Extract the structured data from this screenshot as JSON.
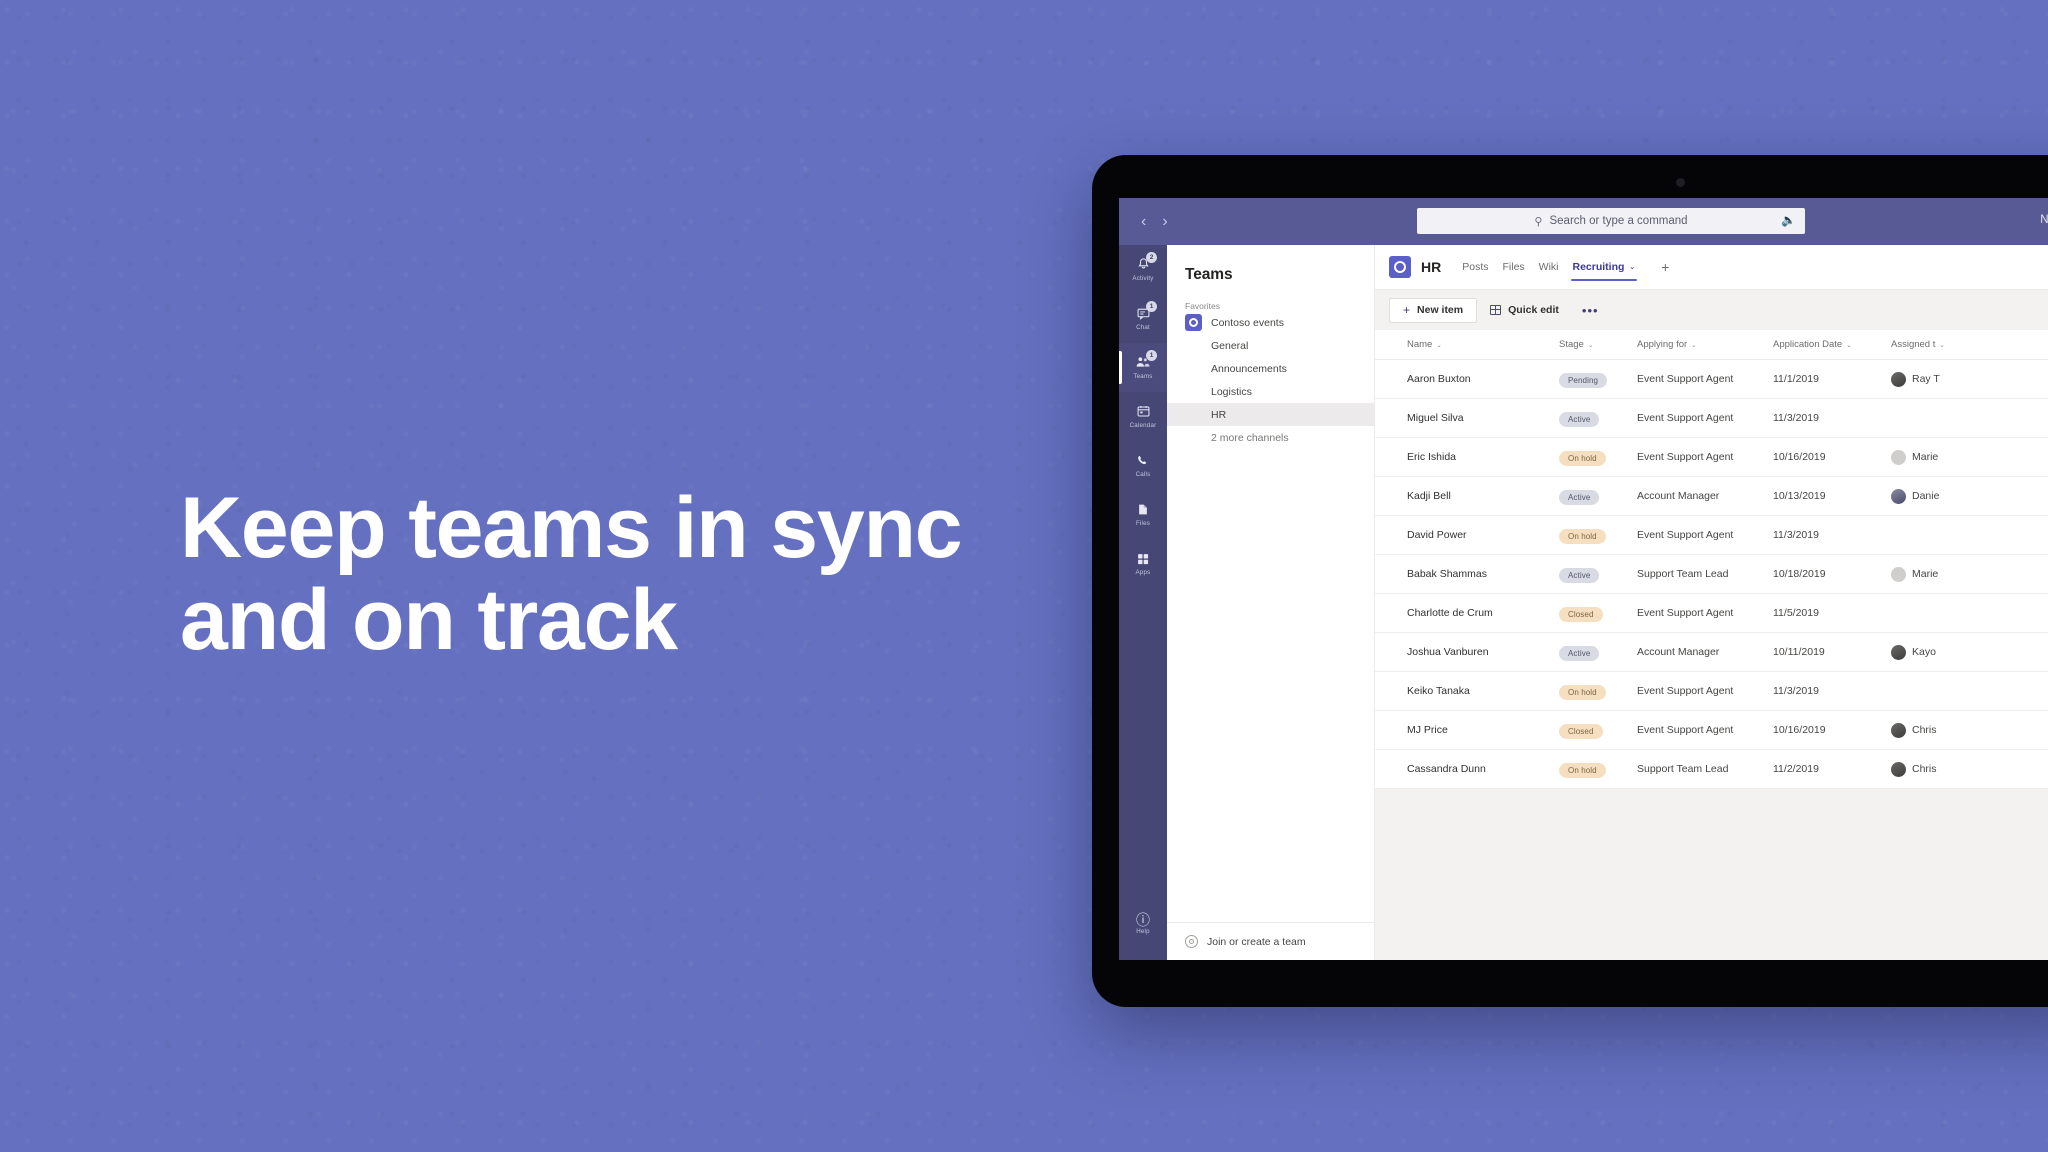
{
  "theme": {
    "background": "#6571c0",
    "teams_purple": "#464775",
    "teams_titlebar": "#585a96",
    "accent": "#5b5fc7",
    "content_bg": "#f3f2f1",
    "pill_gray_bg": "#d8dae4",
    "pill_orange_bg": "#f6dfc0"
  },
  "headline": "Keep teams in sync\nand on track",
  "titlebar": {
    "back_icon": "‹",
    "forward_icon": "›",
    "search_icon": "search-icon",
    "search_placeholder": "Search or type a command",
    "mic_icon": "ƨ",
    "org_name": "Northwind T"
  },
  "rail": {
    "items": [
      {
        "label": "Activity",
        "glyph": "⬤",
        "icon": "bell-icon",
        "badge": "2",
        "active": false
      },
      {
        "label": "Chat",
        "glyph": "⬤",
        "icon": "chat-icon",
        "badge": "1",
        "active": false
      },
      {
        "label": "Teams",
        "glyph": "⬤",
        "icon": "teams-icon",
        "badge": "1",
        "active": true
      },
      {
        "label": "Calendar",
        "glyph": "⬤",
        "icon": "calendar-icon",
        "badge": "",
        "active": false
      },
      {
        "label": "Calls",
        "glyph": "⬤",
        "icon": "phone-icon",
        "badge": "",
        "active": false
      },
      {
        "label": "Files",
        "glyph": "⬤",
        "icon": "files-icon",
        "badge": "",
        "active": false
      },
      {
        "label": "Apps",
        "glyph": "⬤",
        "icon": "apps-grid-icon",
        "badge": "",
        "active": false
      }
    ],
    "help": {
      "label": "Help",
      "icon": "help-circle-icon"
    }
  },
  "teams_panel": {
    "title": "Teams",
    "section_label": "Favorites",
    "team": {
      "name": "Contoso events",
      "icon": "team-avatar-icon"
    },
    "channels": [
      {
        "name": "General",
        "selected": false,
        "muted": false
      },
      {
        "name": "Announcements",
        "selected": false,
        "muted": false
      },
      {
        "name": "Logistics",
        "selected": false,
        "muted": false
      },
      {
        "name": "HR",
        "selected": true,
        "muted": false
      },
      {
        "name": "2 more channels",
        "selected": false,
        "muted": true
      }
    ],
    "join_team": {
      "label": "Join or create a team",
      "icon": "join-team-icon"
    }
  },
  "channel_header": {
    "avatar_icon": "team-avatar-icon",
    "name": "HR",
    "tabs": [
      {
        "label": "Posts",
        "active": false,
        "chevron": false
      },
      {
        "label": "Files",
        "active": false,
        "chevron": false
      },
      {
        "label": "Wiki",
        "active": false,
        "chevron": false
      },
      {
        "label": "Recruiting",
        "active": true,
        "chevron": true
      }
    ],
    "chevron_icon": "⌄",
    "add_tab_icon": "+"
  },
  "list_toolbar": {
    "new_item": {
      "label": "New item",
      "plus": "+",
      "icon": "plus-icon"
    },
    "quick_edit": {
      "label": "Quick edit",
      "icon": "grid-table-icon"
    },
    "more": {
      "label": "•••",
      "icon": "ellipsis-icon"
    }
  },
  "table": {
    "columns": [
      {
        "label": "Name",
        "key": "name"
      },
      {
        "label": "Stage",
        "key": "stage"
      },
      {
        "label": "Applying for",
        "key": "applying_for"
      },
      {
        "label": "Application Date",
        "key": "application_date"
      },
      {
        "label": "Assigned t",
        "key": "assigned_to"
      }
    ],
    "sort_chevron": "⌄",
    "rows": [
      {
        "name": "Aaron Buxton",
        "stage": "Pending",
        "stage_tone": "gray",
        "applying_for": "Event Support Agent",
        "application_date": "11/1/2019",
        "assigned_to": "Ray T",
        "avatar_tone": "dark"
      },
      {
        "name": "Miguel Silva",
        "stage": "Active",
        "stage_tone": "gray",
        "applying_for": "Event Support Agent",
        "application_date": "11/3/2019",
        "assigned_to": "",
        "avatar_tone": ""
      },
      {
        "name": "Eric Ishida",
        "stage": "On hold",
        "stage_tone": "orange",
        "applying_for": "Event Support Agent",
        "application_date": "10/16/2019",
        "assigned_to": "Marie",
        "avatar_tone": "light"
      },
      {
        "name": "Kadji Bell",
        "stage": "Active",
        "stage_tone": "gray",
        "applying_for": "Account Manager",
        "application_date": "10/13/2019",
        "assigned_to": "Danie",
        "avatar_tone": "blue"
      },
      {
        "name": "David Power",
        "stage": "On hold",
        "stage_tone": "orange",
        "applying_for": "Event Support Agent",
        "application_date": "11/3/2019",
        "assigned_to": "",
        "avatar_tone": ""
      },
      {
        "name": "Babak Shammas",
        "stage": "Active",
        "stage_tone": "gray",
        "applying_for": "Support Team Lead",
        "application_date": "10/18/2019",
        "assigned_to": "Marie",
        "avatar_tone": "light"
      },
      {
        "name": "Charlotte de Crum",
        "stage": "Closed",
        "stage_tone": "orange",
        "applying_for": "Event Support Agent",
        "application_date": "11/5/2019",
        "assigned_to": "",
        "avatar_tone": ""
      },
      {
        "name": "Joshua Vanburen",
        "stage": "Active",
        "stage_tone": "gray",
        "applying_for": "Account Manager",
        "application_date": "10/11/2019",
        "assigned_to": "Kayo",
        "avatar_tone": "dark"
      },
      {
        "name": "Keiko Tanaka",
        "stage": "On hold",
        "stage_tone": "orange",
        "applying_for": "Event Support Agent",
        "application_date": "11/3/2019",
        "assigned_to": "",
        "avatar_tone": ""
      },
      {
        "name": "MJ Price",
        "stage": "Closed",
        "stage_tone": "orange",
        "applying_for": "Event Support Agent",
        "application_date": "10/16/2019",
        "assigned_to": "Chris",
        "avatar_tone": "dark"
      },
      {
        "name": "Cassandra Dunn",
        "stage": "On hold",
        "stage_tone": "orange",
        "applying_for": "Support Team Lead",
        "application_date": "11/2/2019",
        "assigned_to": "Chris",
        "avatar_tone": "dark"
      }
    ]
  }
}
